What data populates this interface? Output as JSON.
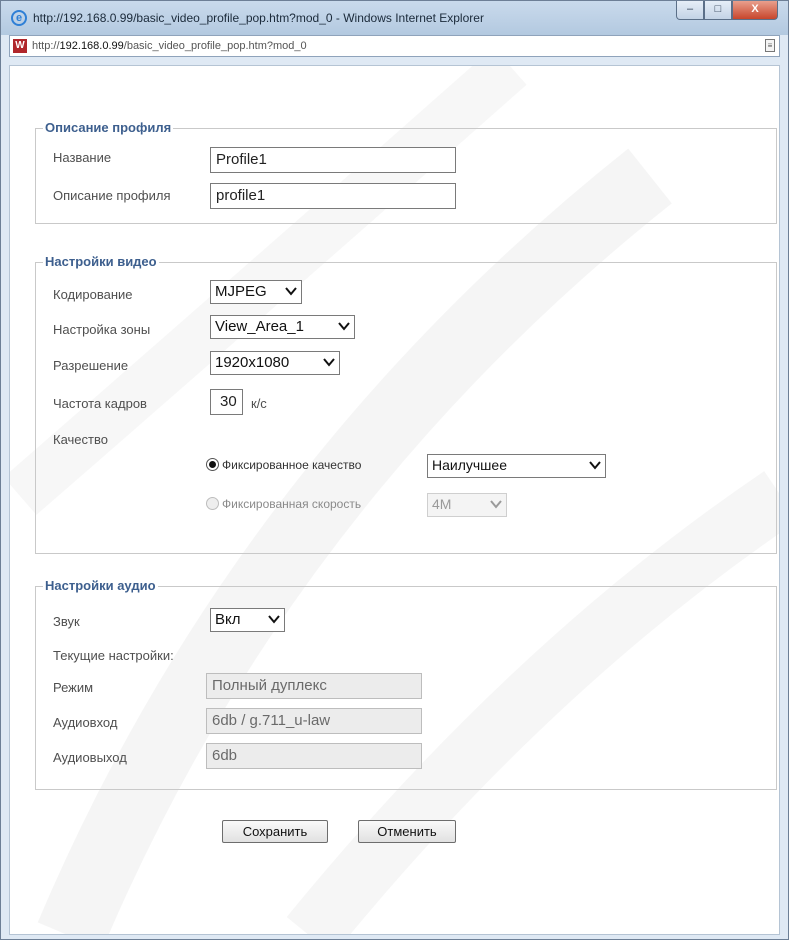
{
  "window": {
    "title": "http://192.168.0.99/basic_video_profile_pop.htm?mod_0 - Windows Internet Explorer",
    "icon": "internet-explorer-icon",
    "buttons": {
      "minimize": "–",
      "maximize": "□",
      "close": "X"
    }
  },
  "address_bar": {
    "url_prefix": "http://",
    "url_host": "192.168.0.99",
    "url_path": "/basic_video_profile_pop.htm?mod_0",
    "site_icon": "site-favicon",
    "site_icon_text": "W"
  },
  "profile_section": {
    "legend": "Описание профиля",
    "name_label": "Название",
    "name_value": "Profile1",
    "description_label": "Описание профиля",
    "description_value": "profile1"
  },
  "video_section": {
    "legend": "Настройки видео",
    "encoding_label": "Кодирование",
    "encoding_value": "MJPEG",
    "zone_label": "Настройка зоны",
    "zone_value": "View_Area_1",
    "resolution_label": "Разрешение",
    "resolution_value": "1920x1080",
    "framerate_label": "Частота кадров",
    "framerate_value": "30",
    "framerate_unit": "к/с",
    "quality_label": "Качество",
    "fixed_quality_label": "Фиксированное качество",
    "fixed_quality_value": "Наилучшее",
    "fixed_quality_checked": true,
    "fixed_bitrate_label": "Фиксированная скорость",
    "fixed_bitrate_value": "4M",
    "fixed_bitrate_checked": false
  },
  "audio_section": {
    "legend": "Настройки аудио",
    "sound_label": "Звук",
    "sound_value": "Вкл",
    "current_settings_label": "Текущие настройки:",
    "mode_label": "Режим",
    "mode_value": "Полный дуплекс",
    "audio_in_label": "Аудиовход",
    "audio_in_value": "6db / g.711_u-law",
    "audio_out_label": "Аудиовыход",
    "audio_out_value": "6db"
  },
  "actions": {
    "save_label": "Сохранить",
    "cancel_label": "Отменить"
  },
  "colors": {
    "legend": "#3d5f8e",
    "titlebar": "#c9daec",
    "close_button": "#c7462c"
  }
}
